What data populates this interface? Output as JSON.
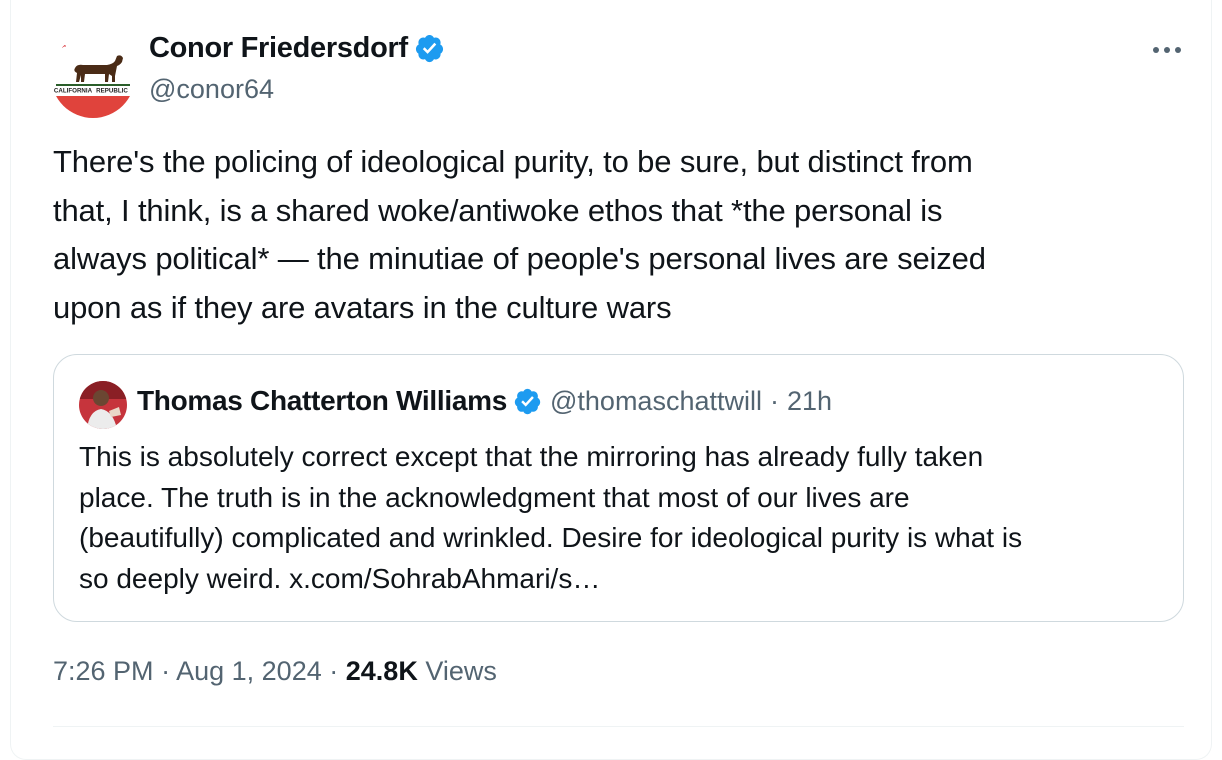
{
  "author": {
    "display_name": "Conor Friedersdorf",
    "handle": "@conor64",
    "avatar_text_left": "CALIFORNIA",
    "avatar_text_right": "REPUBLIC",
    "verified_icon": "verified-badge-icon"
  },
  "tweet": {
    "text": "There's the policing of ideological purity, to be sure, but distinct from\nthat, I think, is a shared woke/antiwoke ethos that *the personal is\nalways political* — the minutiae of people's personal lives are seized\nupon as if they are avatars in the culture wars"
  },
  "quoted_tweet": {
    "display_name": "Thomas Chatterton Williams",
    "handle": "@thomaschattwill",
    "separator": "·",
    "time": "21h",
    "text": "This is absolutely correct except that the mirroring has already fully taken\nplace. The truth is in the acknowledgment that most of our lives are\n(beautifully) complicated and wrinkled. Desire for ideological purity is what is\nso deeply weird. x.com/SohrabAhmari/s…"
  },
  "meta": {
    "time": "7:26 PM",
    "separator": "·",
    "date": "Aug 1, 2024",
    "views_count": "24.8K",
    "views_label": "Views"
  },
  "colors": {
    "text_primary": "#0f1419",
    "text_secondary": "#536471",
    "verified_blue": "#1d9bf0",
    "border": "#cfd9de"
  },
  "icons": {
    "more": "more-options-icon"
  }
}
